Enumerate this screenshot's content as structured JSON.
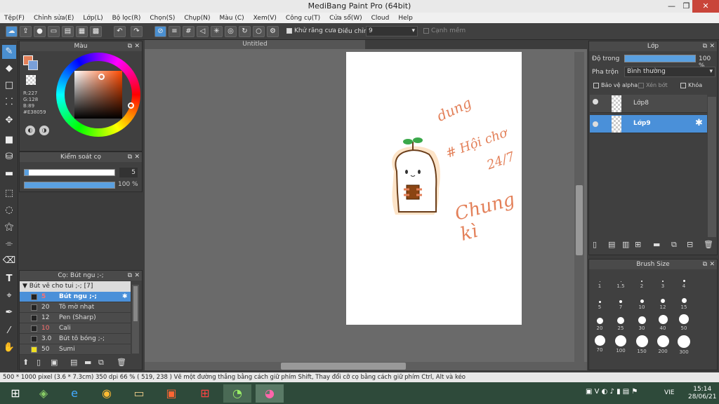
{
  "app": {
    "title": "MediBang Paint Pro (64bit)"
  },
  "menu": [
    "Tệp(F)",
    "Chỉnh sửa(E)",
    "Lớp(L)",
    "Bộ lọc(R)",
    "Chọn(S)",
    "Chụp(N)",
    "Màu (C)",
    "Xem(V)",
    "Công cụ(T)",
    "Cửa sổ(W)",
    "Cloud",
    "Help"
  ],
  "toolbar": {
    "antialias": "Khử răng cưa",
    "adjust_label": "Điều chỉnh",
    "adjust_value": "9",
    "edge": "Cạnh mềm"
  },
  "color_panel": {
    "title": "Màu",
    "r": "R:227",
    "g": "G:128",
    "b": "B:89",
    "hex": "#E38059",
    "color": "#E38059"
  },
  "brush_control": {
    "title": "Kiểm soát cọ",
    "size": "5",
    "opacity": "100 %"
  },
  "brush_panel": {
    "title": "Cọ: Bút ngu ;-;",
    "group": "Bút vẽ cho tui ;-; [7]",
    "items": [
      {
        "size": "5",
        "name": "Bút ngu ;-;"
      },
      {
        "size": "20",
        "name": "Tô mờ nhạt"
      },
      {
        "size": "12",
        "name": "Pen (Sharp)"
      },
      {
        "size": "10",
        "name": "Cali"
      },
      {
        "size": "3.0",
        "name": "Bút tô bóng ;-;"
      },
      {
        "size": "50",
        "name": "Sumi"
      }
    ]
  },
  "document": {
    "tab": "Untitled"
  },
  "canvas_text": {
    "t1": "dung",
    "t2": "# Hội chơ",
    "t3": "24/7",
    "t4": "Chung kì"
  },
  "layer_panel": {
    "title": "Lớp",
    "opacity_label": "Độ trong",
    "opacity_value": "100 %",
    "blend_label": "Pha trộn",
    "blend_value": "Bình thường",
    "protect_alpha": "Bảo vệ alpha",
    "clip": "Xén bớt",
    "lock": "Khóa",
    "layers": [
      {
        "name": "Lớp8"
      },
      {
        "name": "Lớp9"
      }
    ]
  },
  "brush_size_panel": {
    "title": "Brush Size",
    "sizes": [
      "1",
      "1.5",
      "2",
      "3",
      "4",
      "5",
      "7",
      "10",
      "12",
      "15",
      "20",
      "25",
      "30",
      "40",
      "50",
      "70",
      "100",
      "150",
      "200",
      "300"
    ]
  },
  "status": {
    "text": "500 * 1000 pixel   (3.6 * 7.3cm)   350 dpi   66 %   ( 519, 238 )   Vẽ một đường thẳng bằng cách giữ phím Shift, Thay đổi cỡ cọ bằng cách giữ phím Ctrl, Alt và kéo"
  },
  "taskbar": {
    "lang": "VIE",
    "time": "15:14",
    "date": "28/06/21"
  }
}
